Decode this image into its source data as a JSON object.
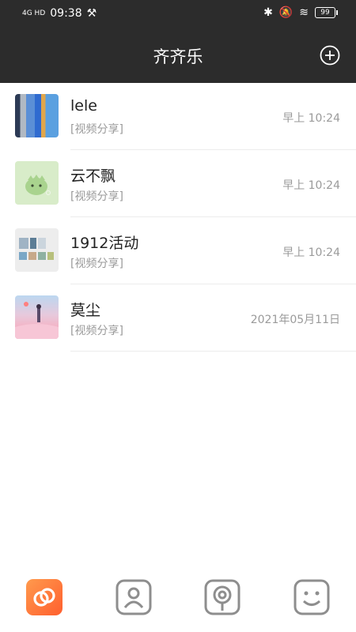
{
  "status_bar": {
    "time": "09:38",
    "network": "4G HD",
    "battery": "99"
  },
  "header": {
    "title": "齐齐乐",
    "add_icon": "plus-circle-icon"
  },
  "chats": [
    {
      "name": "lele",
      "preview": "[视频分享]",
      "time": "早上 10:24"
    },
    {
      "name": "云不飘",
      "preview": "[视频分享]",
      "time": "早上 10:24"
    },
    {
      "name": "1912活动",
      "preview": "[视频分享]",
      "time": "早上 10:24"
    },
    {
      "name": "莫尘",
      "preview": "[视频分享]",
      "time": "2021年05月11日"
    }
  ],
  "tabbar": {
    "items": [
      "link-icon",
      "contacts-icon",
      "discover-icon",
      "profile-smile-icon"
    ],
    "active_color": "#ff7a33"
  }
}
